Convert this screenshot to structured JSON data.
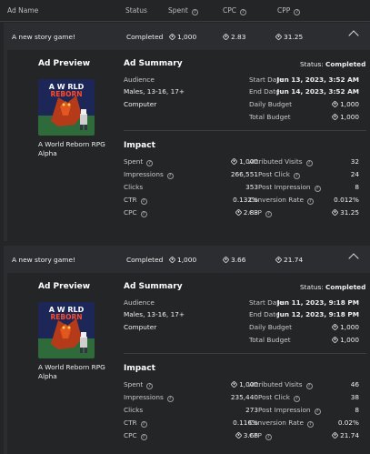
{
  "header": {
    "ad_name": "Ad Name",
    "status": "Status",
    "spent": "Spent",
    "cpc": "CPC",
    "cpp": "CPP"
  },
  "campaigns": [
    {
      "name": "A new story game!",
      "status": "Completed",
      "spent": "1,000",
      "cpc": "2.83",
      "cpp": "31.25",
      "ad_preview": {
        "title": "Ad Preview",
        "thumb_text_1": "A W RLD",
        "thumb_text_2": "REBORN",
        "game_name": "A World Reborn RPG Alpha"
      },
      "ad_summary": {
        "title": "Ad Summary",
        "status_label": "Status:",
        "status_value": "Completed",
        "audience_label": "Audience",
        "audience_value": "Males, 13-16, 17+",
        "device": "Computer",
        "start_label": "Start Date",
        "start_value": "Jun 13, 2023, 3:52 AM",
        "end_label": "End Date",
        "end_value": "Jun 14, 2023, 3:52 AM",
        "daily_label": "Daily Budget",
        "daily_value": "1,000",
        "total_label": "Total Budget",
        "total_value": "1,000"
      },
      "impact": {
        "title": "Impact",
        "spent_label": "Spent",
        "spent_value": "1,000",
        "impressions_label": "Impressions",
        "impressions_value": "266,551",
        "clicks_label": "Clicks",
        "clicks_value": "353",
        "ctr_label": "CTR",
        "ctr_value": "0.132%",
        "cpc_label": "CPC",
        "cpc_value": "2.83",
        "visits_label": "Attributed Visits",
        "visits_value": "32",
        "post_click_label": "Post Click",
        "post_click_value": "24",
        "post_imp_label": "Post Impression",
        "post_imp_value": "8",
        "conv_label": "Conversion Rate",
        "conv_value": "0.012%",
        "cpp_label": "CPP",
        "cpp_value": "31.25"
      }
    },
    {
      "name": "A new story game!",
      "status": "Completed",
      "spent": "1,000",
      "cpc": "3.66",
      "cpp": "21.74",
      "ad_preview": {
        "title": "Ad Preview",
        "thumb_text_1": "A W RLD",
        "thumb_text_2": "REBORN",
        "game_name": "A World Reborn RPG Alpha"
      },
      "ad_summary": {
        "title": "Ad Summary",
        "status_label": "Status:",
        "status_value": "Completed",
        "audience_label": "Audience",
        "audience_value": "Males, 13-16, 17+",
        "device": "Computer",
        "start_label": "Start Date",
        "start_value": "Jun 11, 2023, 9:18 PM",
        "end_label": "End Date",
        "end_value": "Jun 12, 2023, 9:18 PM",
        "daily_label": "Daily Budget",
        "daily_value": "1,000",
        "total_label": "Total Budget",
        "total_value": "1,000"
      },
      "impact": {
        "title": "Impact",
        "spent_label": "Spent",
        "spent_value": "1,000",
        "impressions_label": "Impressions",
        "impressions_value": "235,440",
        "clicks_label": "Clicks",
        "clicks_value": "273",
        "ctr_label": "CTR",
        "ctr_value": "0.116%",
        "cpc_label": "CPC",
        "cpc_value": "3.66",
        "visits_label": "Attributed Visits",
        "visits_value": "46",
        "post_click_label": "Post Click",
        "post_click_value": "38",
        "post_imp_label": "Post Impression",
        "post_imp_value": "8",
        "conv_label": "Conversion Rate",
        "conv_value": "0.02%",
        "cpp_label": "CPP",
        "cpp_value": "21.74"
      }
    }
  ],
  "icons": {
    "info": "info-icon",
    "robux": "robux-icon",
    "collapse": "chevron-up-icon"
  }
}
